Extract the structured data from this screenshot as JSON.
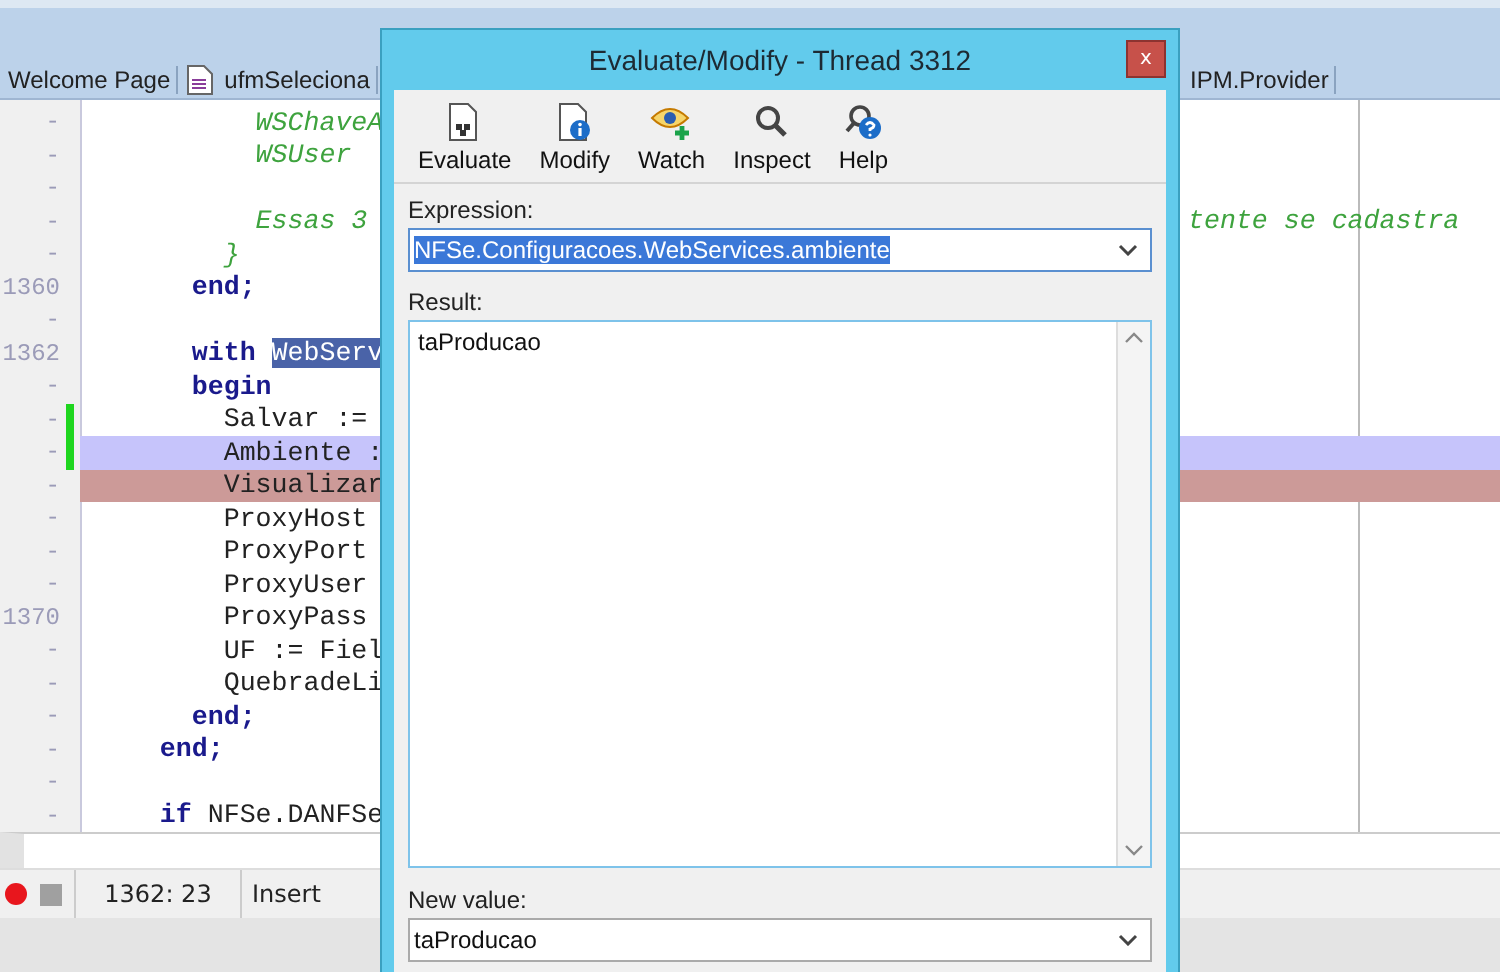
{
  "editor": {
    "tabs": [
      {
        "label": "Welcome Page",
        "kind": "page"
      },
      {
        "label": "ufmSeleciona",
        "kind": "file"
      }
    ],
    "tabs_right": [
      {
        "label": "IPM.Provider"
      }
    ],
    "lines": [
      {
        "gutter": "-",
        "mark": false,
        "kind": "code",
        "code": [
          {
            "text": "          WSChaveA",
            "kind": "comment"
          }
        ]
      },
      {
        "gutter": "-",
        "mark": false,
        "kind": "code",
        "code": [
          {
            "text": "          WSUser",
            "kind": "comment"
          }
        ]
      },
      {
        "gutter": "-",
        "mark": false,
        "kind": "code"
      },
      {
        "gutter": "-",
        "mark": false,
        "kind": "code",
        "code": [
          {
            "text": "          Essas 3",
            "kind": "comment"
          }
        ],
        "right": "tente se cadastra"
      },
      {
        "gutter": "-",
        "mark": false,
        "kind": "code",
        "code": [
          {
            "text": "        }",
            "kind": "comment"
          }
        ]
      },
      {
        "gutter": "1360",
        "mark": false,
        "kind": "code",
        "code": [
          {
            "text": "      end;",
            "kind": "keyword"
          }
        ]
      },
      {
        "gutter": "-",
        "mark": false,
        "kind": "code"
      },
      {
        "gutter": "1362",
        "mark": false,
        "kind": "code",
        "code": [
          {
            "text": "      with ",
            "kind": "keyword"
          },
          {
            "text": "WebServ",
            "kind": "selected"
          }
        ]
      },
      {
        "gutter": "-",
        "mark": false,
        "kind": "code",
        "code": [
          {
            "text": "      begin",
            "kind": "keyword"
          }
        ]
      },
      {
        "gutter": "-",
        "mark": true,
        "kind": "code",
        "code": [
          {
            "text": "        Salvar :=",
            "kind": "plain"
          }
        ]
      },
      {
        "gutter": "-",
        "mark": true,
        "kind": "execution",
        "code": [
          {
            "text": "        Ambiente :",
            "kind": "plain"
          }
        ]
      },
      {
        "gutter": "-",
        "mark": false,
        "kind": "breakpoint",
        "code": [
          {
            "text": "        Visualizar",
            "kind": "plain"
          }
        ]
      },
      {
        "gutter": "-",
        "mark": false,
        "kind": "code",
        "code": [
          {
            "text": "        ProxyHost",
            "kind": "plain"
          }
        ]
      },
      {
        "gutter": "-",
        "mark": false,
        "kind": "code",
        "code": [
          {
            "text": "        ProxyPort",
            "kind": "plain"
          }
        ]
      },
      {
        "gutter": "-",
        "mark": false,
        "kind": "code",
        "code": [
          {
            "text": "        ProxyUser",
            "kind": "plain"
          }
        ]
      },
      {
        "gutter": "1370",
        "mark": false,
        "kind": "code",
        "code": [
          {
            "text": "        ProxyPass",
            "kind": "plain"
          }
        ]
      },
      {
        "gutter": "-",
        "mark": false,
        "kind": "code",
        "code": [
          {
            "text": "        UF := Fiel",
            "kind": "plain"
          }
        ]
      },
      {
        "gutter": "-",
        "mark": false,
        "kind": "code",
        "code": [
          {
            "text": "        QuebradeLi",
            "kind": "plain"
          }
        ]
      },
      {
        "gutter": "-",
        "mark": false,
        "kind": "code",
        "code": [
          {
            "text": "      end;",
            "kind": "keyword"
          }
        ]
      },
      {
        "gutter": "-",
        "mark": false,
        "kind": "code",
        "code": [
          {
            "text": "    end;",
            "kind": "keyword"
          }
        ]
      },
      {
        "gutter": "-",
        "mark": false,
        "kind": "code"
      },
      {
        "gutter": "-",
        "mark": false,
        "kind": "code",
        "code": [
          {
            "text": "    if",
            "kind": "keyword"
          },
          {
            "text": " NFSe.DANFSe",
            "kind": "plain"
          }
        ]
      }
    ]
  },
  "status_bar": {
    "position": "1362: 23",
    "mode": "Insert"
  },
  "dialog": {
    "title": "Evaluate/Modify - Thread 3312",
    "close": "x",
    "toolbar": [
      {
        "label": "Evaluate",
        "kind": "evaluate"
      },
      {
        "label": "Modify",
        "kind": "modify"
      },
      {
        "label": "Watch",
        "kind": "watch"
      },
      {
        "label": "Inspect",
        "kind": "inspect"
      },
      {
        "label": "Help",
        "kind": "help"
      }
    ],
    "expression_label": "Expression:",
    "expression": "NFSe.Configuracoes.WebServices.ambiente",
    "result_label": "Result:",
    "result": "taProducao",
    "new_value_label": "New value:",
    "new_value": "taProducao"
  }
}
